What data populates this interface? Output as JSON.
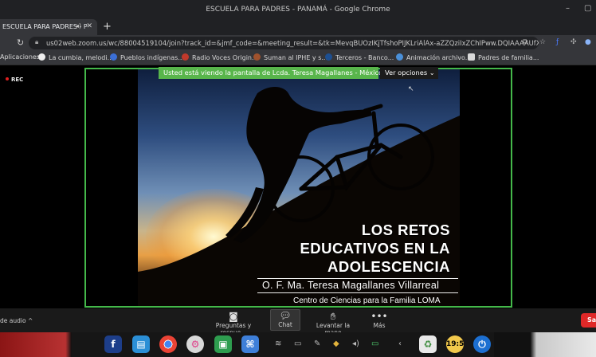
{
  "window": {
    "title": "ESCUELA PARA PADRES - PANAMÁ - Google Chrome"
  },
  "tab": {
    "label": "ESCUELA PARA PADRES - P"
  },
  "omnibox": {
    "url": "us02web.zoom.us/wc/88004519104/join?track_id=&jmf_code=&meeting_result=&tk=MevqBUOzIKjTfshoPIJKLriAlAx-aZZQziIxZChIPww.DQIAAAAUfXpkw..."
  },
  "bookmarks": [
    {
      "label": "Aplicaciones",
      "color": "#8ab4f8"
    },
    {
      "label": "La cumbia, melodi...",
      "color": "#ffffff"
    },
    {
      "label": "Pueblos indígenas...",
      "color": "#3b6fd6"
    },
    {
      "label": "Radio Voces Origin...",
      "color": "#c0392b"
    },
    {
      "label": "Suman al IPHE y s...",
      "color": "#a0522d"
    },
    {
      "label": "Terceros - Banco...",
      "color": "#1d4f91"
    },
    {
      "label": "Animación archivo...",
      "color": "#4a90d9"
    },
    {
      "label": "Padres de familia...",
      "color": "#d9d9d9"
    }
  ],
  "meeting": {
    "rec_label": "REC",
    "share_banner": "Usted está viendo la pantalla de Lcda. Teresa Magallanes - México",
    "view_options": "Ver opciones"
  },
  "slide": {
    "title_lines": [
      "LOS RETOS",
      "EDUCATIVOS EN LA",
      "ADOLESCENCIA"
    ],
    "author": "O. F. Ma. Teresa Magallanes Villarreal",
    "organization": "Centro de Ciencias para la Familia LOMA"
  },
  "zoom_controls": {
    "audio": "de audio",
    "qa": "Preguntas y respue...",
    "chat": "Chat",
    "raise_hand": "Levantar la mano",
    "more": "Más",
    "leave": "Sal"
  },
  "taskbar": {
    "clock": "19:5"
  },
  "colors": {
    "share_border": "#44b84a",
    "leave_red": "#e02828",
    "banner_green": "#58b54b"
  }
}
